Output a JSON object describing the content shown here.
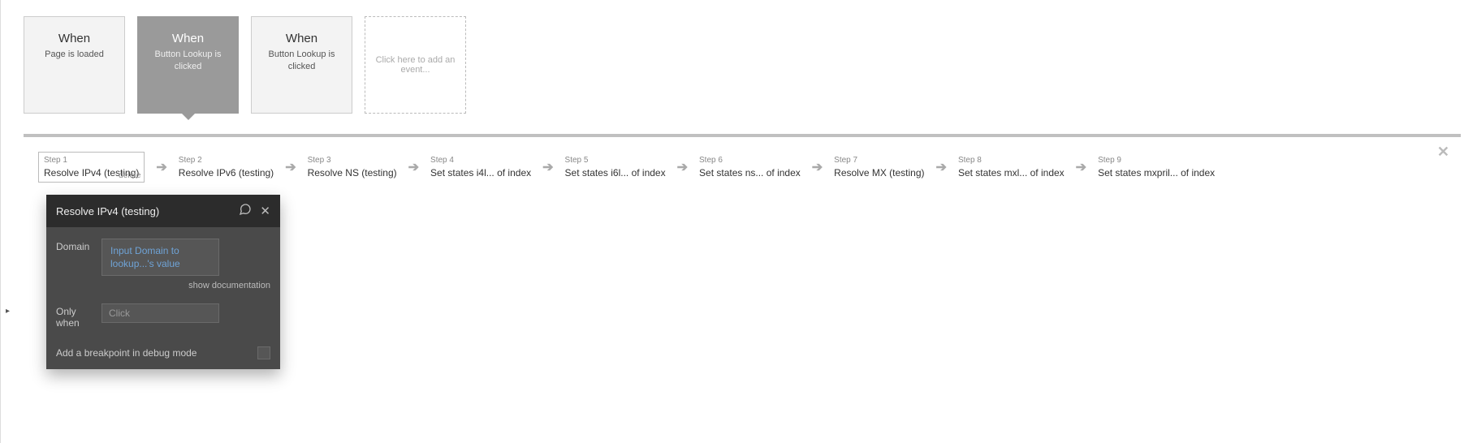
{
  "events": [
    {
      "when": "When",
      "desc": "Page is loaded",
      "selected": false
    },
    {
      "when": "When",
      "desc": "Button Lookup is clicked",
      "selected": true
    },
    {
      "when": "When",
      "desc": "Button Lookup is clicked",
      "selected": false
    }
  ],
  "addEventText": "Click here to add an event...",
  "steps": [
    {
      "label": "Step 1",
      "name": "Resolve IPv4 (testing)",
      "focused": true,
      "delete": "delete"
    },
    {
      "label": "Step 2",
      "name": "Resolve IPv6 (testing)"
    },
    {
      "label": "Step 3",
      "name": "Resolve NS (testing)"
    },
    {
      "label": "Step 4",
      "name": "Set states i4l... of index"
    },
    {
      "label": "Step 5",
      "name": "Set states i6l... of index"
    },
    {
      "label": "Step 6",
      "name": "Set states ns... of index"
    },
    {
      "label": "Step 7",
      "name": "Resolve MX (testing)"
    },
    {
      "label": "Step 8",
      "name": "Set states mxl... of index"
    },
    {
      "label": "Step 9",
      "name": "Set states mxpril... of index"
    }
  ],
  "closeGlyph": "✕",
  "arrowGlyph": "➔",
  "editor": {
    "title": "Resolve IPv4 (testing)",
    "domainLabel": "Domain",
    "domainValue": "Input Domain to lookup...'s value",
    "docLink": "show documentation",
    "onlyWhenLabel": "Only when",
    "onlyWhenPlaceholder": "Click",
    "breakpointLabel": "Add a breakpoint in debug mode"
  },
  "commentGlyph": "💬",
  "handleGlyph": "▸"
}
